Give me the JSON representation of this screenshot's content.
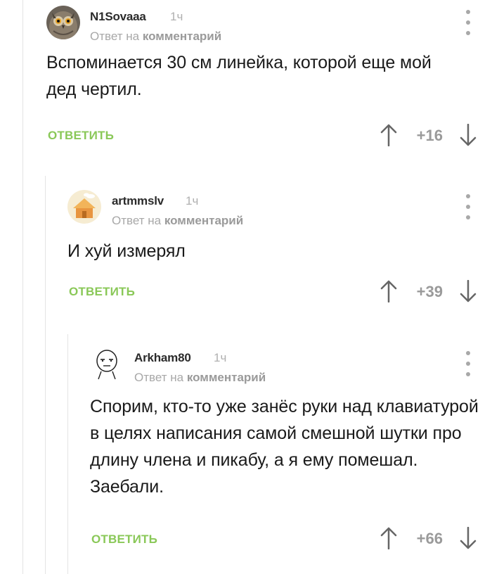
{
  "comments": [
    {
      "username": "N1Sovaaa",
      "time": "1ч",
      "reply_prefix": "Ответ на",
      "reply_target": "комментарий",
      "text": "Вспоминается 30 см линейка, которой еще мой дед чертил.",
      "reply_label": "ОТВЕТИТЬ",
      "rating": "+16",
      "avatar_icon": "owl-avatar-icon"
    },
    {
      "username": "artmmslv",
      "time": "1ч",
      "reply_prefix": "Ответ на",
      "reply_target": "комментарий",
      "text": "И хуй измерял",
      "reply_label": "ОТВЕТИТЬ",
      "rating": "+39",
      "avatar_icon": "house-avatar-icon"
    },
    {
      "username": "Arkham80",
      "time": "1ч",
      "reply_prefix": "Ответ на",
      "reply_target": "комментарий",
      "text": "Спорим, кто-то уже занёс руки над клавиатурой в целях написания самой смешной шутки про длину члена и пикабу, а я ему помешал. Заебали.",
      "reply_label": "ОТВЕТИТЬ",
      "rating": "+66",
      "avatar_icon": "meme-face-avatar-icon"
    }
  ],
  "colors": {
    "accent_green": "#8ac858",
    "muted_gray": "#a8a8a8",
    "text": "#1a1a1a"
  }
}
